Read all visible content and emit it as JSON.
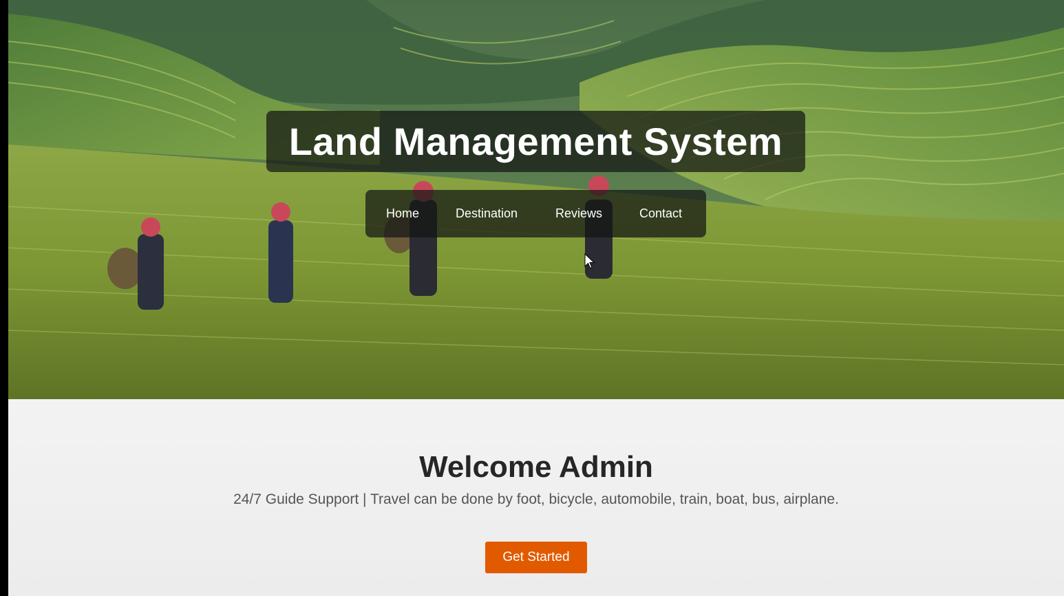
{
  "hero": {
    "title": "Land Management System",
    "image_description_icon": "rice-terrace-landscape"
  },
  "nav": {
    "items": [
      {
        "label": "Home"
      },
      {
        "label": "Destination"
      },
      {
        "label": "Reviews"
      },
      {
        "label": "Contact"
      }
    ]
  },
  "welcome": {
    "heading": "Welcome Admin",
    "subtext": "24/7 Guide Support | Travel can be done by foot, bicycle, automobile, train, boat, bus, airplane.",
    "cta_label": "Get Started"
  },
  "colors": {
    "accent": "#e25a00",
    "overlay": "#141614",
    "page_bg": "#f2f2f2",
    "heading": "#262626",
    "body_text": "#555555"
  }
}
